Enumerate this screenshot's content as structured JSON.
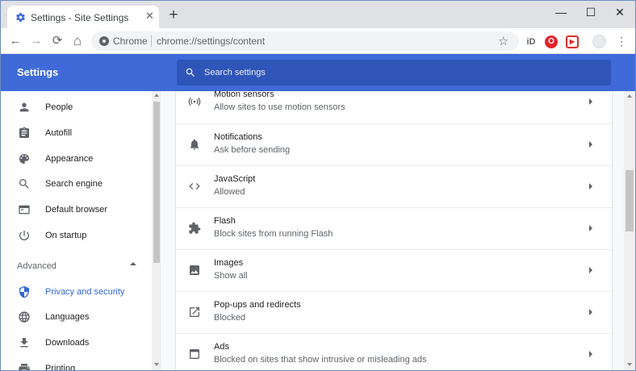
{
  "colors": {
    "accent": "#3f6ad8",
    "search_bg": "#2f55b8",
    "active_nav": "#3367d6",
    "tab_strip": "#dfe1e5",
    "ext_opera_red": "#e0242a",
    "ext_red": "#d93025"
  },
  "tab": {
    "title": "Settings - Site Settings",
    "favicon": "gear-icon",
    "close_glyph": "✕",
    "new_tab_glyph": "+"
  },
  "window_controls": {
    "minimize": "—",
    "maximize": "☐",
    "close": "✕"
  },
  "toolbar": {
    "back_glyph": "←",
    "forward_glyph": "→",
    "reload_glyph": "⟳",
    "home_glyph": "⌂",
    "chip": "Chrome",
    "url": "chrome://settings/content",
    "star_glyph": "☆",
    "extensions": [
      {
        "icon": "id-extension-icon",
        "glyph": "iD"
      },
      {
        "icon": "opera-extension-icon",
        "glyph": "O"
      },
      {
        "icon": "red-extension-icon",
        "glyph": "▶"
      }
    ],
    "menu_glyph": "⋮"
  },
  "header": {
    "title": "Settings",
    "search_placeholder": "Search settings"
  },
  "sidebar": {
    "items": [
      {
        "label": "People",
        "icon": "person-icon"
      },
      {
        "label": "Autofill",
        "icon": "clipboard-icon"
      },
      {
        "label": "Appearance",
        "icon": "palette-icon"
      },
      {
        "label": "Search engine",
        "icon": "search-icon"
      },
      {
        "label": "Default browser",
        "icon": "browser-window-icon"
      },
      {
        "label": "On startup",
        "icon": "power-icon"
      }
    ],
    "advanced_label": "Advanced",
    "advanced_items": [
      {
        "label": "Privacy and security",
        "icon": "shield-icon",
        "active": true
      },
      {
        "label": "Languages",
        "icon": "globe-icon"
      },
      {
        "label": "Downloads",
        "icon": "download-icon"
      },
      {
        "label": "Printing",
        "icon": "printer-icon"
      }
    ]
  },
  "content": {
    "rows": [
      {
        "title": "Motion sensors",
        "subtitle": "Allow sites to use motion sensors",
        "icon": "motion-sensor-icon"
      },
      {
        "title": "Notifications",
        "subtitle": "Ask before sending",
        "icon": "bell-icon"
      },
      {
        "title": "JavaScript",
        "subtitle": "Allowed",
        "icon": "code-icon"
      },
      {
        "title": "Flash",
        "subtitle": "Block sites from running Flash",
        "icon": "puzzle-icon"
      },
      {
        "title": "Images",
        "subtitle": "Show all",
        "icon": "image-icon"
      },
      {
        "title": "Pop-ups and redirects",
        "subtitle": "Blocked",
        "icon": "open-in-new-icon"
      },
      {
        "title": "Ads",
        "subtitle": "Blocked on sites that show intrusive or misleading ads",
        "icon": "ads-window-icon"
      }
    ]
  }
}
